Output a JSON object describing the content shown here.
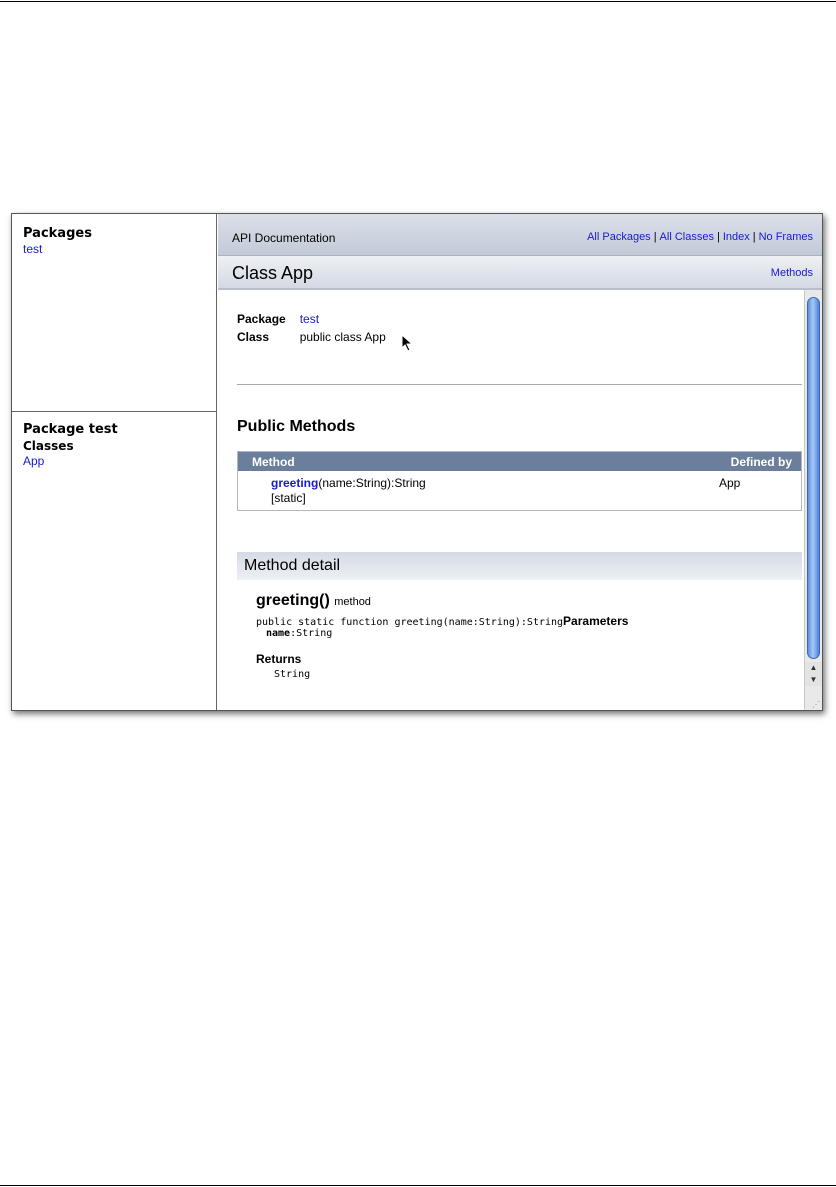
{
  "frames": {
    "packages": {
      "heading": "Packages",
      "items": [
        "test"
      ]
    },
    "package_detail": {
      "heading": "Package test",
      "classes_label": "Classes",
      "items": [
        "App"
      ]
    }
  },
  "header": {
    "title": "API Documentation",
    "nav": [
      "All Packages",
      "All Classes",
      "Index",
      "No Frames"
    ],
    "nav_separator": "|"
  },
  "class_bar": {
    "title": "Class App",
    "methods_link": "Methods"
  },
  "info": {
    "package_label": "Package",
    "package_value": "test",
    "class_label": "Class",
    "class_value": "public class App"
  },
  "public_methods": {
    "title": "Public Methods",
    "col_method": "Method",
    "col_defined_by": "Defined by",
    "rows": [
      {
        "name": "greeting",
        "signature": "(name:String):String",
        "modifier": "[static]",
        "defined_by": "App"
      }
    ]
  },
  "method_detail": {
    "title": "Method detail",
    "name": "greeting()",
    "kind": "method",
    "code": "public static function greeting(name:String):String",
    "parameters_label": "Parameters",
    "param_name": "name",
    "param_type": ":String",
    "returns_label": "Returns",
    "returns_value": "String"
  },
  "scrollbar": {
    "up_icon": "▲",
    "down_icon": "▼",
    "grip_icon": "⋰"
  },
  "colors": {
    "link": "#1a1acc",
    "table_header": "#6b7f9c",
    "scroll_thumb": "#5d8fe0"
  }
}
